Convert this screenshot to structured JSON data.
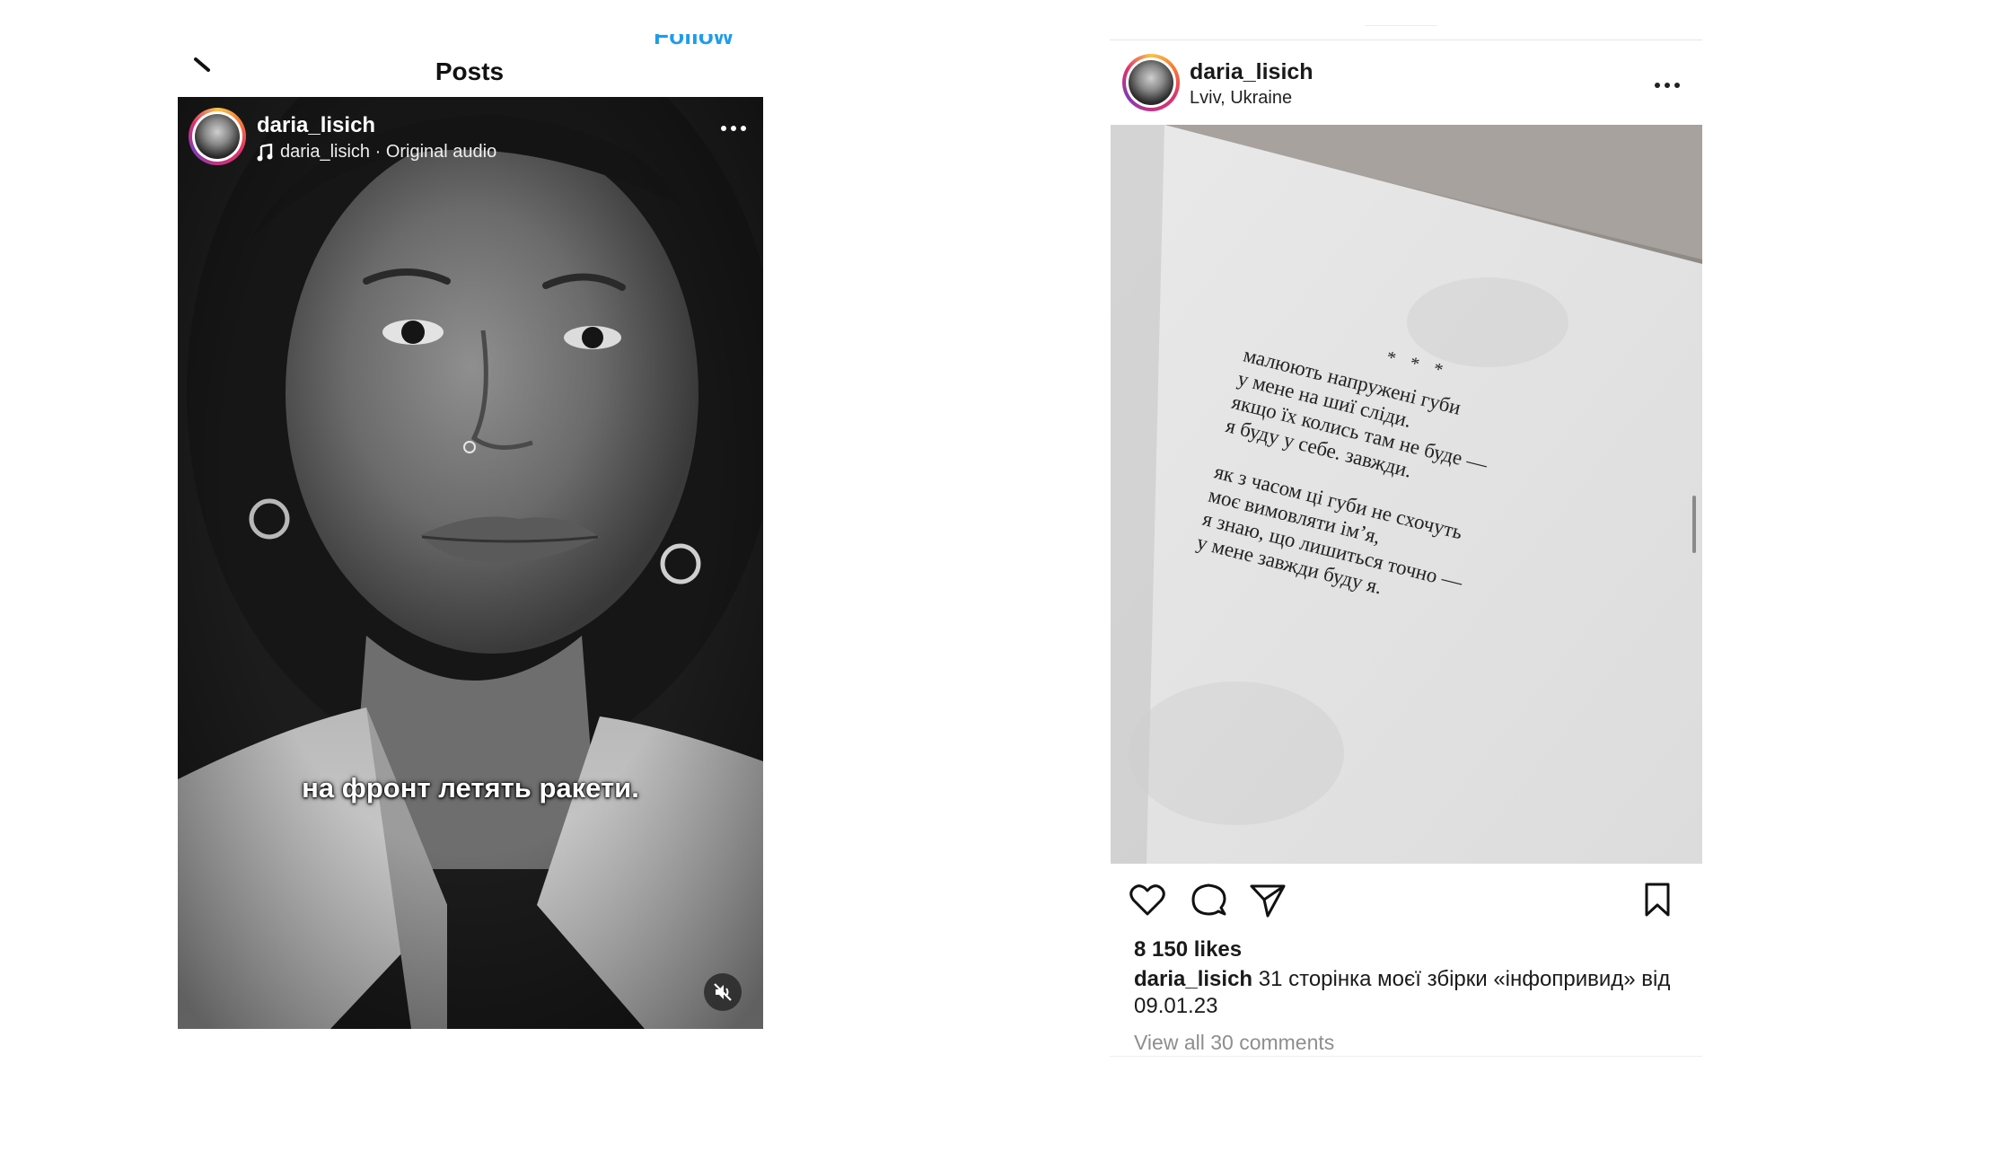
{
  "left": {
    "header_title": "Posts",
    "follow_label": "Follow",
    "reel": {
      "username": "daria_lisich",
      "audio": "daria_lisich · Original audio",
      "subtitle": "на фронт летять ракети.",
      "icons": [
        "back-arrow-icon",
        "music-note-icon",
        "more-icon",
        "mute-icon"
      ]
    }
  },
  "right": {
    "post": {
      "username": "daria_lisich",
      "location": "Lviv, Ukraine",
      "image_text": {
        "stars": "* * *",
        "stanza1": [
          "малюють напружені губи",
          "у мене на шиї сліди.",
          "якщо їх колись там не буде —",
          "я буду у себе. завжди."
        ],
        "stanza2": [
          "як з часом ці губи не схочуть",
          "моє вимовляти ім’я,",
          "я знаю, що лишиться точно —",
          "у мене завжди буду я."
        ]
      },
      "likes": "8 150 likes",
      "caption_user": "daria_lisich",
      "caption_text": "31 сторінка моєї збірки «інфопривид» від 09.01.23",
      "comments_link": "View all 30 comments",
      "icons": [
        "heart-icon",
        "comment-icon",
        "share-icon",
        "bookmark-icon",
        "more-icon"
      ]
    }
  },
  "colors": {
    "link_blue": "#1f9ceb",
    "muted_gray": "#8e8e8e"
  }
}
